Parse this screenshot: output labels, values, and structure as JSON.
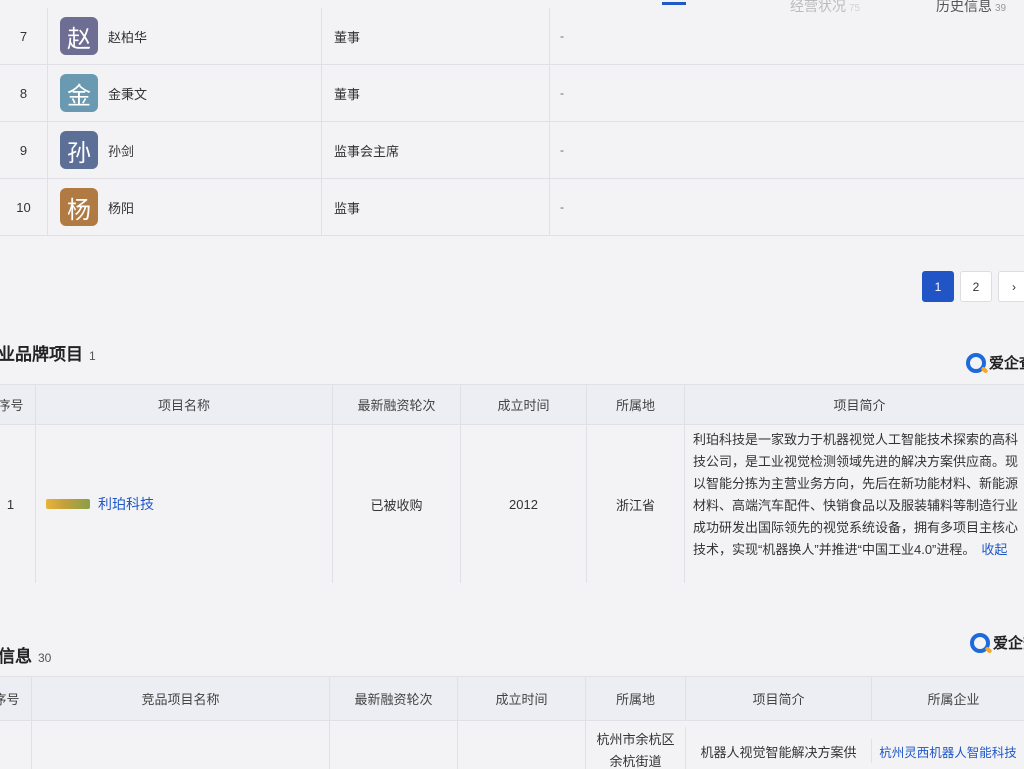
{
  "tabs": [
    {
      "label": "经营状况",
      "count": "75"
    },
    {
      "label": "历史信息",
      "count": "39"
    }
  ],
  "members": [
    {
      "num": "7",
      "avatar_char": "赵",
      "avatar_color": "#6e6e94",
      "name": "赵柏华",
      "role": "董事",
      "extra": "-"
    },
    {
      "num": "8",
      "avatar_char": "金",
      "avatar_color": "#6a9ab2",
      "name": "金秉文",
      "role": "董事",
      "extra": "-"
    },
    {
      "num": "9",
      "avatar_char": "孙",
      "avatar_color": "#5c6f96",
      "name": "孙剑",
      "role": "监事会主席",
      "extra": "-"
    },
    {
      "num": "10",
      "avatar_char": "杨",
      "avatar_color": "#b27a43",
      "name": "杨阳",
      "role": "监事",
      "extra": "-"
    }
  ],
  "pagination": {
    "pages": [
      "1",
      "2"
    ],
    "current": "1",
    "next_icon": "chevron-right-icon",
    "next_glyph": "›"
  },
  "brand_section": {
    "title": "业品牌项目",
    "count": "1",
    "badge": "爱企查",
    "columns": [
      "序号",
      "项目名称",
      "最新融资轮次",
      "成立时间",
      "所属地",
      "项目简介"
    ],
    "rows": [
      {
        "num": "1",
        "name": "利珀科技",
        "round": "已被收购",
        "founded": "2012",
        "location": "浙江省",
        "intro": "利珀科技是一家致力于机器视觉人工智能技术探索的高科技公司，是工业视觉检测领域先进的解决方案供应商。现以智能分拣为主营业务方向，先后在新功能材料、新能源材料、高端汽车配件、快销食品以及服装辅料等制造行业成功研发出国际领先的视觉系统设备，拥有多项目主核心技术，实现“机器换人”并推进“中国工业4.0”进程。",
        "collapse": "收起"
      }
    ]
  },
  "competitor_section": {
    "title": "信息",
    "count": "30",
    "badge": "爱企查",
    "columns": [
      "序号",
      "竞品项目名称",
      "最新融资轮次",
      "成立时间",
      "所属地",
      "项目简介",
      "所属企业"
    ],
    "rows": [
      {
        "location": "杭州市余杭区余杭街道",
        "intro": "机器人视觉智能解决方案供",
        "company": "杭州灵西机器人智能科技"
      }
    ]
  }
}
